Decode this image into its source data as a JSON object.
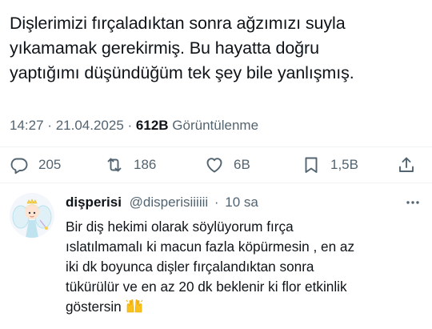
{
  "tweet": {
    "lines": [
      "Dişlerimizi fırçaladıktan sonra ağzımızı suyla",
      "yıkamamak gerekirmiş. Bu hayatta doğru",
      "yaptığımı düşündüğüm tek şey bile yanlışmış."
    ],
    "time": "14:27",
    "date": "21.04.2025",
    "separator": "·",
    "views_count": "612B",
    "views_label": "Görüntülenme"
  },
  "actions": {
    "replies": "205",
    "reposts": "186",
    "likes": "6B",
    "bookmarks": "1,5B"
  },
  "reply": {
    "display_name": "dişperisi",
    "handle": "@disperisiiiiii",
    "separator": "·",
    "time_ago": "10 sa",
    "lines": [
      "Bir diş hekimi olarak söylüyorum fırça",
      "ıslatılmamalı ki macun fazla köpürmesin , en az",
      "iki dk boyunca dişler fırçalandıktan sonra",
      "tükürülür ve en az 20 dk beklenir ki flor etkinlik",
      "göstersin"
    ],
    "emoji": "raising-hands"
  },
  "colors": {
    "text": "#0f1419",
    "secondary": "#536471",
    "divider": "#eff3f4"
  }
}
